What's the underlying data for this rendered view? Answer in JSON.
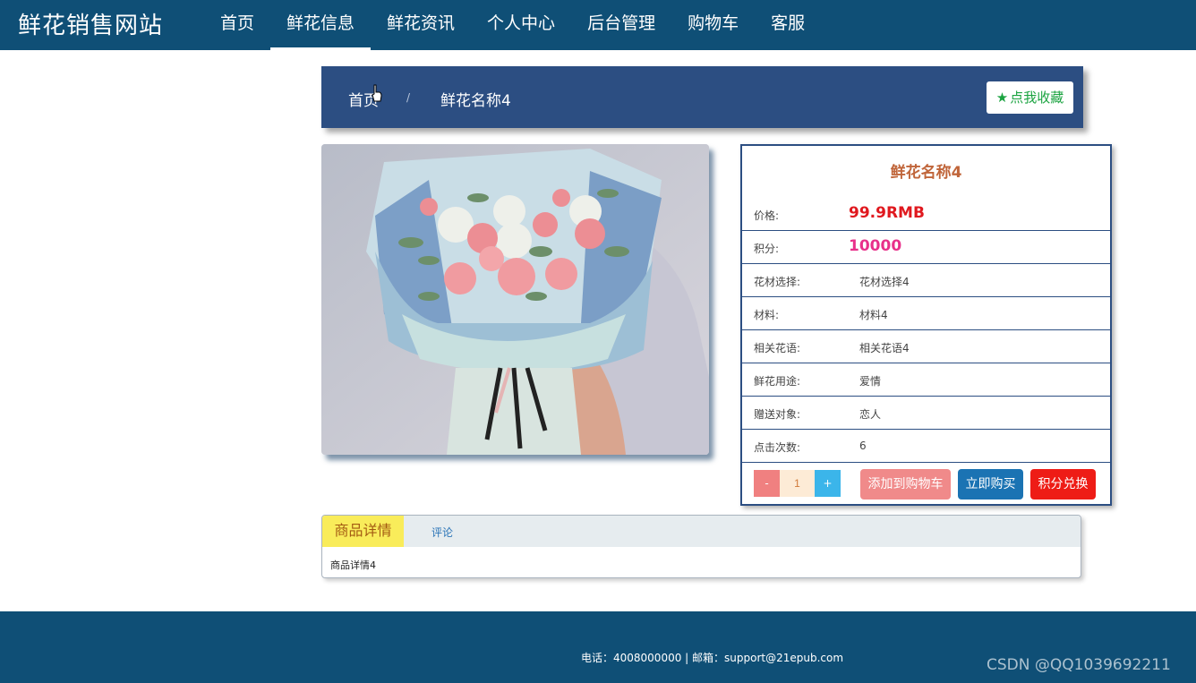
{
  "header": {
    "logo": "鲜花销售网站",
    "nav": [
      {
        "label": "首页"
      },
      {
        "label": "鲜花信息",
        "active": true
      },
      {
        "label": "鲜花资讯"
      },
      {
        "label": "个人中心"
      },
      {
        "label": "后台管理"
      },
      {
        "label": "购物车"
      },
      {
        "label": "客服"
      }
    ]
  },
  "breadcrumb": {
    "home": "首页",
    "separator": "/",
    "current": "鲜花名称4",
    "favorite_label": "点我收藏"
  },
  "product": {
    "name": "鲜花名称4",
    "rows": [
      {
        "label": "价格:",
        "value": "99.9RMB"
      },
      {
        "label": "积分:",
        "value": "10000"
      },
      {
        "label": "花材选择:",
        "value": "花材选择4"
      },
      {
        "label": "材料:",
        "value": "材料4"
      },
      {
        "label": "相关花语:",
        "value": "相关花语4"
      },
      {
        "label": "鲜花用途:",
        "value": "爱情"
      },
      {
        "label": "赠送对象:",
        "value": "恋人"
      },
      {
        "label": "点击次数:",
        "value": "6"
      }
    ],
    "quantity": {
      "minus": "-",
      "value": "1",
      "plus": "+"
    },
    "buttons": {
      "cart": "添加到购物车",
      "buy": "立即购买",
      "exchange": "积分兑换"
    }
  },
  "tabs": {
    "detail": "商品详情",
    "comment": "评论",
    "content": "商品详情4"
  },
  "footer": {
    "contact": "电话：4008000000 | 邮箱：support@21epub.com",
    "watermark": "CSDN @QQ1039692211"
  },
  "colors": {
    "header_bg": "#0f4f76",
    "crumb_bg": "#2c4e82",
    "price": "#e0191f",
    "points": "#e8308a"
  }
}
